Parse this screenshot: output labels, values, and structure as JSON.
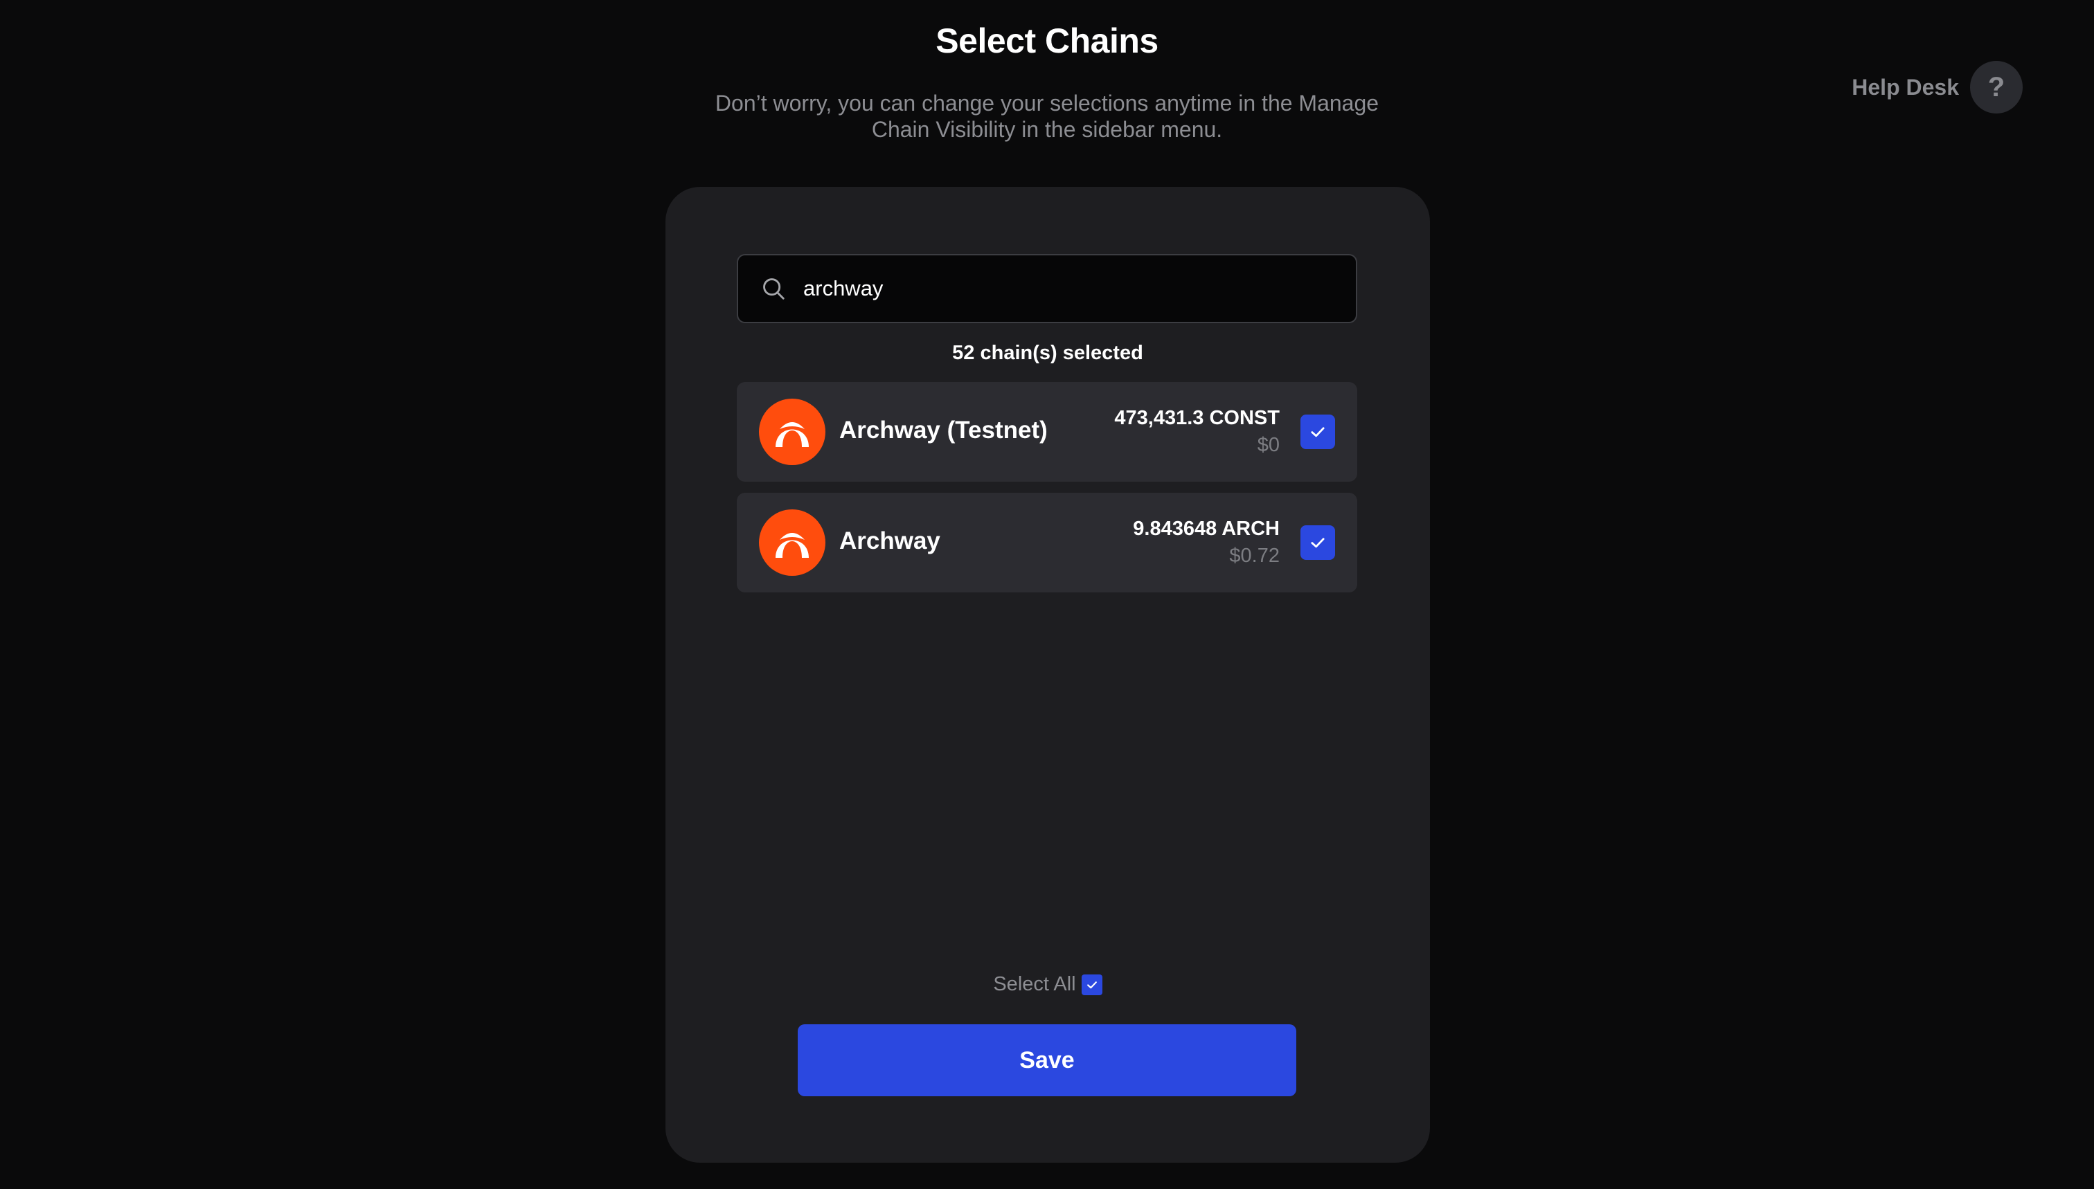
{
  "header": {
    "title": "Select Chains",
    "subtitle": "Don’t worry, you can change your selections anytime in the Manage Chain Visibility in the sidebar menu."
  },
  "help": {
    "label": "Help Desk",
    "icon_glyph": "?"
  },
  "search": {
    "value": "archway",
    "icon": "search-icon"
  },
  "selected_count": "52 chain(s) selected",
  "chains": [
    {
      "name": "Archway (Testnet)",
      "amount": "473,431.3 CONST",
      "usd": "$0",
      "checked": true,
      "logo": "archway-logo"
    },
    {
      "name": "Archway",
      "amount": "9.843648 ARCH",
      "usd": "$0.72",
      "checked": true,
      "logo": "archway-logo"
    }
  ],
  "select_all": {
    "label": "Select All",
    "checked": true
  },
  "save_label": "Save",
  "colors": {
    "background": "#0a0a0b",
    "card": "#1e1e21",
    "row": "#2c2c31",
    "accent": "#2b48e0",
    "archway_orange": "#ff4d0d"
  }
}
